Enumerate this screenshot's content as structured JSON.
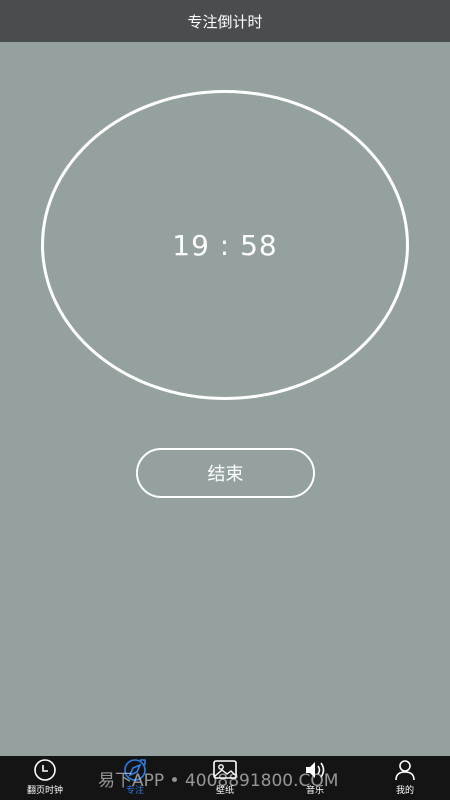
{
  "header": {
    "title": "专注倒计时"
  },
  "timer": {
    "display": "19 : 58"
  },
  "actions": {
    "end_label": "结束"
  },
  "tabbar": {
    "active_color": "#2f7de6",
    "items": [
      {
        "label": "翻页时钟",
        "icon": "clock-icon"
      },
      {
        "label": "专注",
        "icon": "focus-compass-icon",
        "active": true
      },
      {
        "label": "壁纸",
        "icon": "image-icon"
      },
      {
        "label": "音乐",
        "icon": "speaker-icon"
      },
      {
        "label": "我的",
        "icon": "user-icon"
      }
    ]
  },
  "watermark": {
    "text": "易下APP • 4008891800.COM"
  }
}
